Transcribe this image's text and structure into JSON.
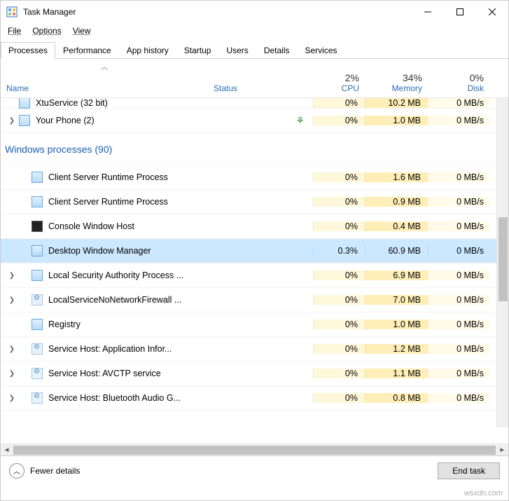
{
  "title": "Task Manager",
  "menu": {
    "file": "File",
    "options": "Options",
    "view": "View"
  },
  "tabs": {
    "processes": "Processes",
    "performance": "Performance",
    "apphistory": "App history",
    "startup": "Startup",
    "users": "Users",
    "details": "Details",
    "services": "Services"
  },
  "columns": {
    "name": "Name",
    "status": "Status",
    "cpu": {
      "pct": "2%",
      "label": "CPU"
    },
    "memory": {
      "pct": "34%",
      "label": "Memory"
    },
    "disk": {
      "pct": "0%",
      "label": "Disk"
    }
  },
  "group": "Windows processes (90)",
  "rows": [
    {
      "name": "XtuService (32 bit)",
      "cpu": "0%",
      "mem": "10.2 MB",
      "disk": "0 MB/s",
      "partial": true,
      "expand": false,
      "icon": "app"
    },
    {
      "name": "Your Phone (2)",
      "cpu": "0%",
      "mem": "1.0 MB",
      "disk": "0 MB/s",
      "expand": true,
      "icon": "app",
      "leaf": true
    },
    {
      "name": "Client Server Runtime Process",
      "cpu": "0%",
      "mem": "1.6 MB",
      "disk": "0 MB/s",
      "icon": "app"
    },
    {
      "name": "Client Server Runtime Process",
      "cpu": "0%",
      "mem": "0.9 MB",
      "disk": "0 MB/s",
      "icon": "app"
    },
    {
      "name": "Console Window Host",
      "cpu": "0%",
      "mem": "0.4 MB",
      "disk": "0 MB/s",
      "icon": "cmd"
    },
    {
      "name": "Desktop Window Manager",
      "cpu": "0.3%",
      "mem": "60.9 MB",
      "disk": "0 MB/s",
      "icon": "app",
      "selected": true
    },
    {
      "name": "Local Security Authority Process ...",
      "cpu": "0%",
      "mem": "6.9 MB",
      "disk": "0 MB/s",
      "expand": true,
      "icon": "app"
    },
    {
      "name": "LocalServiceNoNetworkFirewall ...",
      "cpu": "0%",
      "mem": "7.0 MB",
      "disk": "0 MB/s",
      "expand": true,
      "icon": "gear"
    },
    {
      "name": "Registry",
      "cpu": "0%",
      "mem": "1.0 MB",
      "disk": "0 MB/s",
      "icon": "app"
    },
    {
      "name": "Service Host: Application Infor...",
      "cpu": "0%",
      "mem": "1.2 MB",
      "disk": "0 MB/s",
      "expand": true,
      "icon": "gear"
    },
    {
      "name": "Service Host: AVCTP service",
      "cpu": "0%",
      "mem": "1.1 MB",
      "disk": "0 MB/s",
      "expand": true,
      "icon": "gear"
    },
    {
      "name": "Service Host: Bluetooth Audio G...",
      "cpu": "0%",
      "mem": "0.8 MB",
      "disk": "0 MB/s",
      "expand": true,
      "icon": "gear"
    }
  ],
  "footer": {
    "fewer": "Fewer details",
    "endtask": "End task"
  },
  "watermark": "wsxdn.com"
}
